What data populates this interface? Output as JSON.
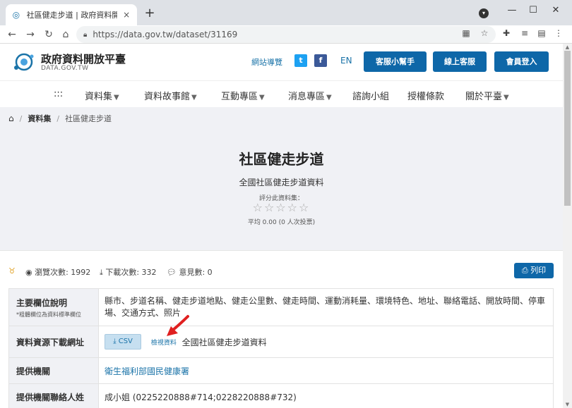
{
  "browser": {
    "tab_title": "社區健走步道 | 政府資料開放平臺",
    "tab_close": "×",
    "new_tab": "+",
    "url": "https://data.gov.tw/dataset/31169",
    "window_minimize": "—",
    "window_maximize": "☐",
    "window_close": "✕"
  },
  "site": {
    "logo_title": "政府資料開放平臺",
    "logo_sub": "DATA.GOV.TW",
    "guide_link": "網站導覽",
    "lang": "EN",
    "buttons": [
      "客服小幫手",
      "線上客服",
      "會員登入"
    ]
  },
  "nav": {
    "menu_icon": ":::",
    "items": [
      {
        "label": "資料集",
        "has_dropdown": true
      },
      {
        "label": "資料故事館",
        "has_dropdown": true
      },
      {
        "label": "互動專區",
        "has_dropdown": true
      },
      {
        "label": "消息專區",
        "has_dropdown": true
      },
      {
        "label": "諮詢小組",
        "has_dropdown": false
      },
      {
        "label": "授權條款",
        "has_dropdown": false
      },
      {
        "label": "關於平臺",
        "has_dropdown": true
      }
    ]
  },
  "breadcrumb": {
    "sep": "/",
    "section": "資料集",
    "current": "社區健走步道"
  },
  "dataset": {
    "title": "社區健走步道",
    "description": "全國社區健走步道資料",
    "rate_label": "評分此資料集：",
    "stars": "☆☆☆☆☆",
    "rating_summary": "平均 0.00 (0 人次投票)"
  },
  "stats": {
    "views": "瀏覽次數: 1992",
    "downloads": "下載次數: 332",
    "comments": "意見數: 0",
    "print_label": "列印"
  },
  "table": {
    "fields_header": "主要欄位說明",
    "fields_note": "*粗體欄位為資料標準欄位",
    "fields_value": "縣市、步道名稱、健走步道地點、健走公里數、健走時間、運動消耗量、環境特色、地址、聯絡電話、開放時間、停車場、交通方式、照片",
    "download_header": "資料資源下載網址",
    "csv_label": "CSV",
    "view_label": "檢視資料",
    "resource_name": "全國社區健走步道資料",
    "provider_header": "提供機關",
    "provider_value": "衛生福利部國民健康署",
    "contact_header": "提供機關聯絡人姓",
    "contact_value": "成小姐 (0225220888#714;0228220888#732)"
  },
  "colors": {
    "primary": "#0e67a8",
    "link": "#1a73a8",
    "hero_bg": "#f0f1f5",
    "twitter": "#1da1f2",
    "facebook": "#3b5998",
    "annotation_arrow": "#e02020"
  }
}
